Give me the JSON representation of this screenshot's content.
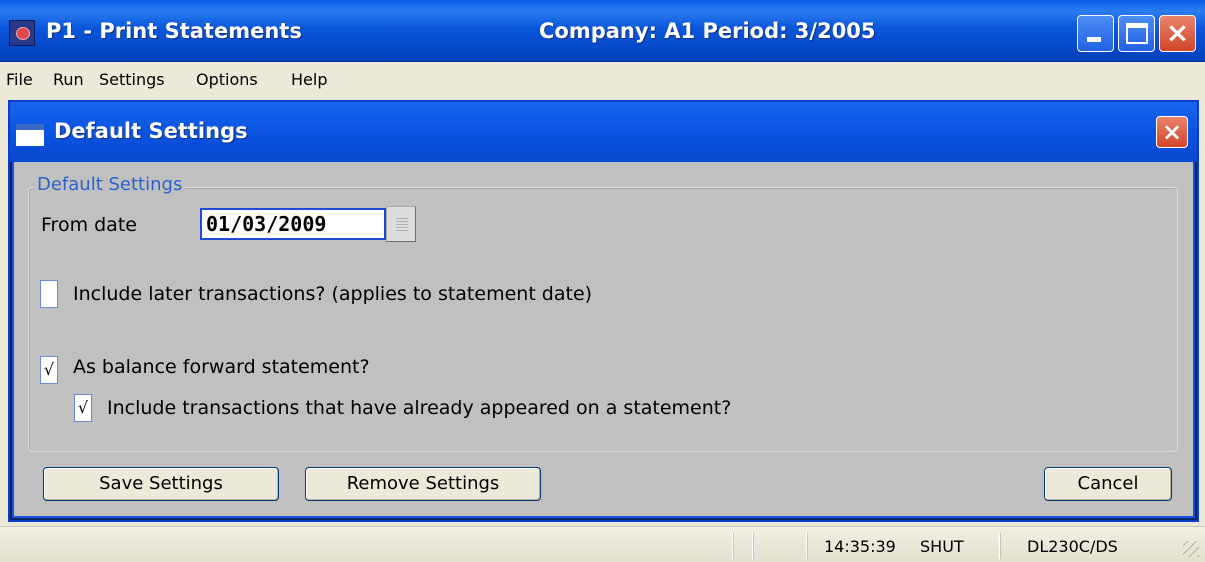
{
  "window": {
    "title": "P1 - Print Statements",
    "context": "Company: A1  Period:  3/2005",
    "icon": "app-icon",
    "controls": [
      "minimize-icon",
      "maximize-icon",
      "close-icon"
    ]
  },
  "menu": {
    "items": [
      "File",
      "Run",
      "Settings",
      "Options",
      "Help"
    ]
  },
  "dialog": {
    "title": "Default Settings",
    "group_legend": "Default Settings",
    "from_date_label": "From date",
    "from_date_value": "01/03/2009",
    "include_later_label": "Include later transactions? (applies to statement date)",
    "include_later_checked": false,
    "balance_forward_label": "As balance forward statement?",
    "balance_forward_checked": true,
    "balance_forward_mark": "√",
    "include_appeared_label": "Include transactions that have already appeared on a statement?",
    "include_appeared_checked": true,
    "include_appeared_mark": "√",
    "buttons": {
      "save": "Save Settings",
      "remove": "Remove Settings",
      "cancel": "Cancel"
    }
  },
  "status_bar": {
    "time": "14:35:39",
    "user": "SHUT",
    "system": "DL230C/DS"
  },
  "colors": {
    "title_bar": "#0b57dc",
    "dialog_body": "#c0c0c0",
    "legend_text": "#2a63c8",
    "close_button": "#d2452a"
  }
}
